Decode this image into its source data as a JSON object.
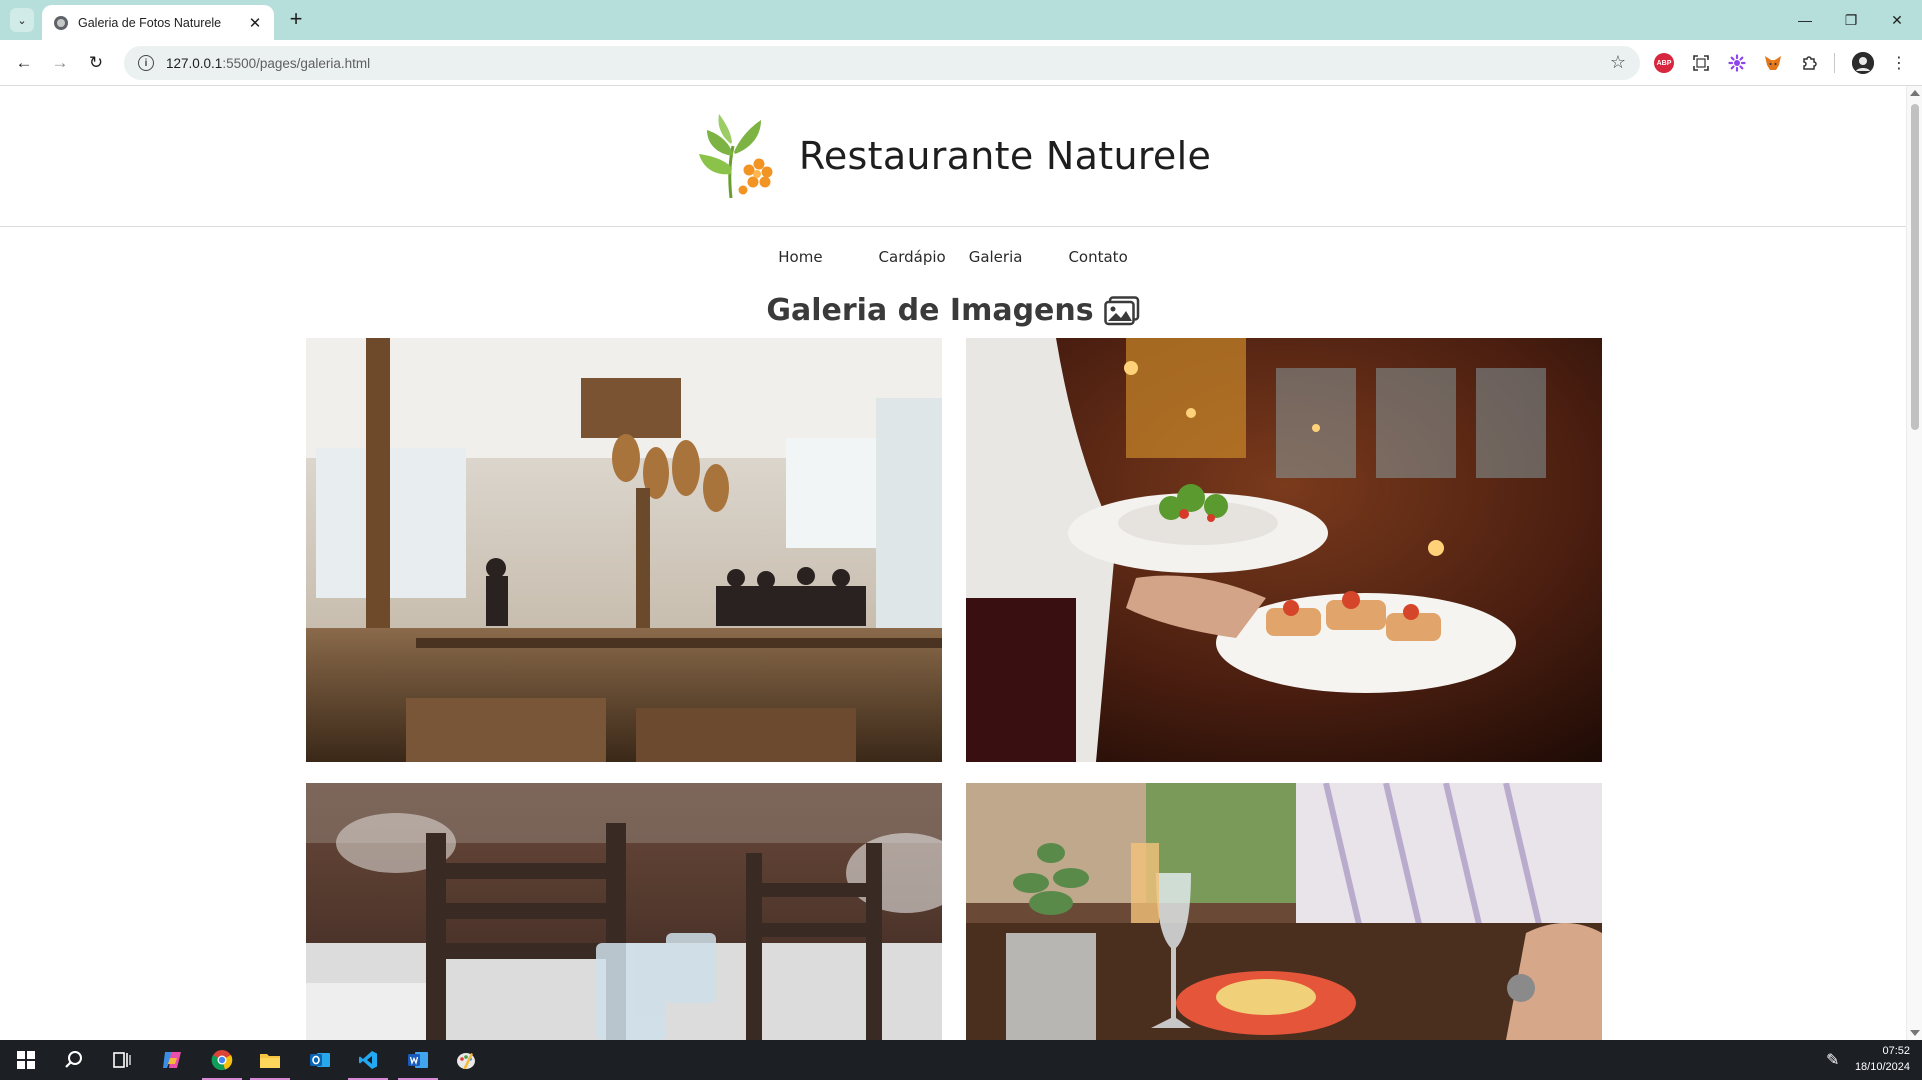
{
  "browser": {
    "tab_title": "Galeria de Fotos Naturele",
    "tab_close": "✕",
    "new_tab": "+",
    "url_host": "127.0.0.1",
    "url_path": ":5500/pages/galeria.html",
    "window_controls": {
      "minimize": "—",
      "restore": "❐",
      "close": "✕"
    },
    "extensions": [
      "adblock-icon",
      "screenshot-icon",
      "sparkle-extension-icon",
      "metamask-fox-icon",
      "puzzle-extensions-icon",
      "profile-avatar",
      "menu-dots-icon"
    ],
    "abp_label": "ABP"
  },
  "site": {
    "title": "Restaurante Naturele",
    "menu": [
      {
        "label": "Home"
      },
      {
        "label": "Cardápio"
      },
      {
        "label": "Galeria"
      },
      {
        "label": "Contato"
      }
    ],
    "gallery_heading": "Galeria de Imagens"
  },
  "colors": {
    "tabbar": "#b6dfdc",
    "leaf_green": "#7cb342",
    "flower_orange": "#f29424",
    "taskbar": "#1c1f24"
  },
  "taskbar": {
    "apps": [
      "windows-start-icon",
      "search-icon",
      "task-view-icon",
      "copilot-icon",
      "chrome-icon",
      "file-explorer-icon",
      "outlook-icon",
      "vscode-icon",
      "word-icon",
      "paint-icon"
    ],
    "time": "07:52",
    "date": "18/10/2024"
  }
}
